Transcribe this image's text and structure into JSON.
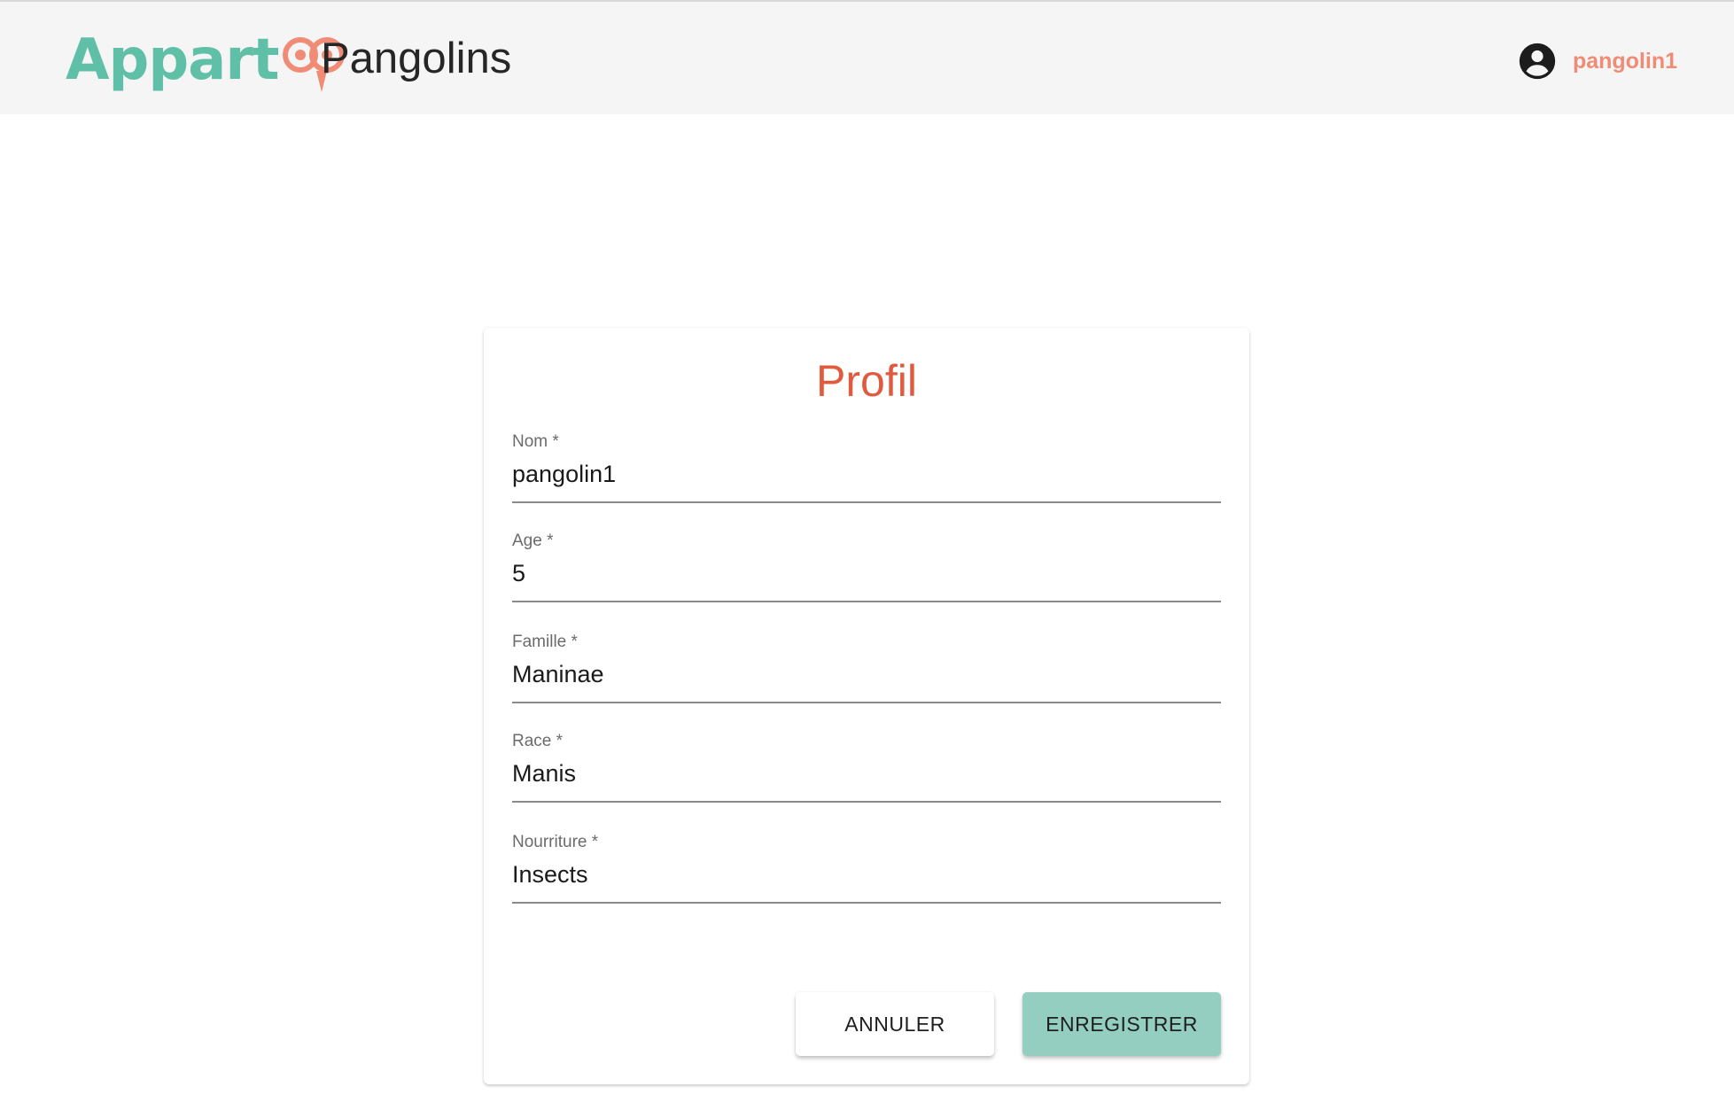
{
  "header": {
    "logo_text": "Appart",
    "app_title": "Pangolins",
    "user_name": "pangolin1",
    "user_icon": "account-circle-icon"
  },
  "form": {
    "title": "Profil",
    "fields": [
      {
        "label": "Nom *",
        "value": "pangolin1"
      },
      {
        "label": "Age *",
        "value": "5"
      },
      {
        "label": "Famille *",
        "value": "Maninae"
      },
      {
        "label": "Race *",
        "value": "Manis"
      },
      {
        "label": "Nourriture *",
        "value": "Insects"
      }
    ],
    "cancel_label": "ANNULER",
    "save_label": "ENREGISTRER"
  },
  "colors": {
    "brand_teal": "#5fbfa7",
    "brand_coral": "#f08c75",
    "title_orange": "#e05a3f",
    "save_button": "#94cec0",
    "header_bg": "#f5f5f5"
  }
}
